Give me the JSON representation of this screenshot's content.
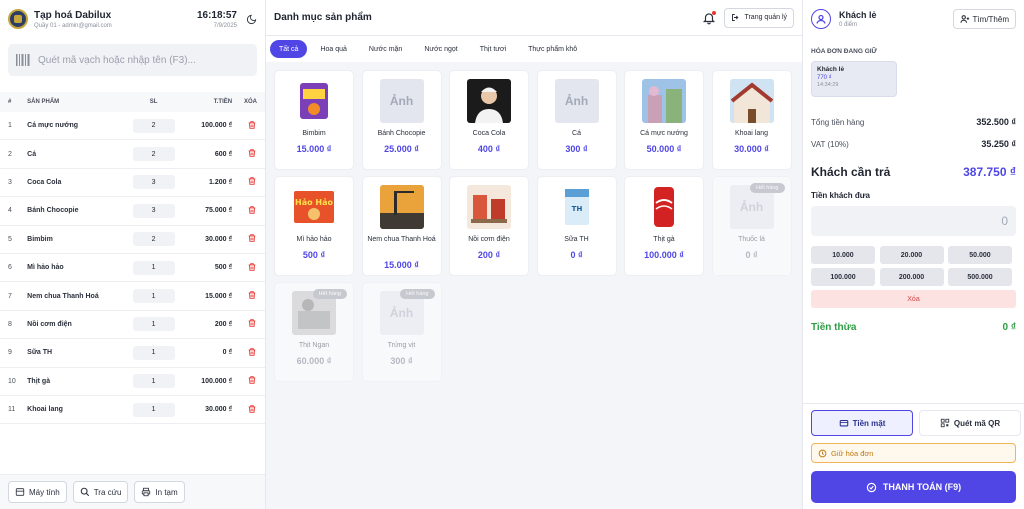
{
  "brand": {
    "name": "Tạp hoá Dabilux",
    "sub": "Quầy 01 - admin@gmail.com"
  },
  "clock": {
    "time": "16:18:57",
    "date": "7/9/2025"
  },
  "search": {
    "placeholder": "Quét mã vạch hoặc nhập tên (F3)..."
  },
  "cart": {
    "headers": {
      "no": "#",
      "product": "SẢN PHẨM",
      "qty": "SL",
      "total": "T.TIỀN",
      "delete": "XÓA"
    },
    "items": [
      {
        "no": "1",
        "name": "Cá mực nướng",
        "qty": "2",
        "total": "100.000 ₫"
      },
      {
        "no": "2",
        "name": "Cá",
        "qty": "2",
        "total": "600 ₫"
      },
      {
        "no": "3",
        "name": "Coca Cola",
        "qty": "3",
        "total": "1.200 ₫"
      },
      {
        "no": "4",
        "name": "Bánh Chocopie",
        "qty": "3",
        "total": "75.000 ₫"
      },
      {
        "no": "5",
        "name": "Bimbim",
        "qty": "2",
        "total": "30.000 ₫"
      },
      {
        "no": "6",
        "name": "Mì hảo hảo",
        "qty": "1",
        "total": "500 ₫"
      },
      {
        "no": "7",
        "name": "Nem chua Thanh Hoá",
        "qty": "1",
        "total": "15.000 ₫"
      },
      {
        "no": "8",
        "name": "Nồi cơm điện",
        "qty": "1",
        "total": "200 ₫"
      },
      {
        "no": "9",
        "name": "Sữa TH",
        "qty": "1",
        "total": "0 ₫"
      },
      {
        "no": "10",
        "name": "Thịt gà",
        "qty": "1",
        "total": "100.000 ₫"
      },
      {
        "no": "11",
        "name": "Khoai lang",
        "qty": "1",
        "total": "30.000 ₫"
      }
    ]
  },
  "footer": {
    "calc": "Máy tính",
    "lookup": "Tra cứu",
    "print": "In tạm"
  },
  "catalog": {
    "title": "Danh mục sản phẩm",
    "manage": "Trang quản lý",
    "tabs": [
      "Tất cả",
      "Hoa quả",
      "Nước mặn",
      "Nước ngọt",
      "Thịt tươi",
      "Thực phẩm khô"
    ],
    "placeholder_text": "Ảnh",
    "out_badge": "Hết hàng",
    "products": [
      {
        "name": "Bimbim",
        "price": "15.000 ₫",
        "img": "snack",
        "out": false
      },
      {
        "name": "Bánh Chocopie",
        "price": "25.000 ₫",
        "img": "placeholder",
        "out": false
      },
      {
        "name": "Coca Cola",
        "price": "400 ₫",
        "img": "person",
        "out": false
      },
      {
        "name": "Cá",
        "price": "300 ₫",
        "img": "placeholder",
        "out": false
      },
      {
        "name": "Cá mực nướng",
        "price": "50.000 ₫",
        "img": "scene",
        "out": false
      },
      {
        "name": "Khoai lang",
        "price": "30.000 ₫",
        "img": "house",
        "out": false
      },
      {
        "name": "Mì hảo hảo",
        "price": "500 ₫",
        "img": "noodle",
        "out": false
      },
      {
        "name": "Nem chua Thanh Hoá",
        "price": "15.000 ₫",
        "img": "construction",
        "out": false
      },
      {
        "name": "Nồi cơm điện",
        "price": "200 ₫",
        "img": "shop",
        "out": false
      },
      {
        "name": "Sữa TH",
        "price": "0 ₫",
        "img": "milk",
        "out": false
      },
      {
        "name": "Thịt gà",
        "price": "100.000 ₫",
        "img": "can",
        "out": false
      },
      {
        "name": "Thuốc lá",
        "price": "0 ₫",
        "img": "placeholder",
        "out": true
      },
      {
        "name": "Thịt Ngan",
        "price": "60.000 ₫",
        "img": "meat",
        "out": true
      },
      {
        "name": "Trứng vịt",
        "price": "300 ₫",
        "img": "placeholder",
        "out": true
      }
    ]
  },
  "customer": {
    "name": "Khách lẻ",
    "points": "0 điểm",
    "find": "Tìm/Thêm"
  },
  "held": {
    "title": "HÓA ĐƠN ĐANG GIỮ",
    "name": "Khách lẻ",
    "amount": "770 ₫",
    "time": "14:34:29"
  },
  "summary": {
    "subtotal_label": "Tổng tiền hàng",
    "subtotal": "352.500 ₫",
    "vat_label": "VAT (10%)",
    "vat": "35.250 ₫",
    "due_label": "Khách cần trả",
    "due": "387.750 ₫"
  },
  "payment": {
    "given_label": "Tiền khách đưa",
    "given_value": "0",
    "quick": [
      "10.000",
      "20.000",
      "50.000",
      "100.000",
      "200.000",
      "500.000"
    ],
    "clear": "Xóa",
    "change_label": "Tiền thừa",
    "change": "0 ₫",
    "cash": "Tiền mặt",
    "qr": "Quét mã QR",
    "hold": "Giữ hóa đơn",
    "pay": "THANH TOÁN (F9)"
  },
  "colors": {
    "accent": "#4f46e5",
    "success": "#2e9e44",
    "danger": "#d64545",
    "warn": "#c07a12"
  }
}
